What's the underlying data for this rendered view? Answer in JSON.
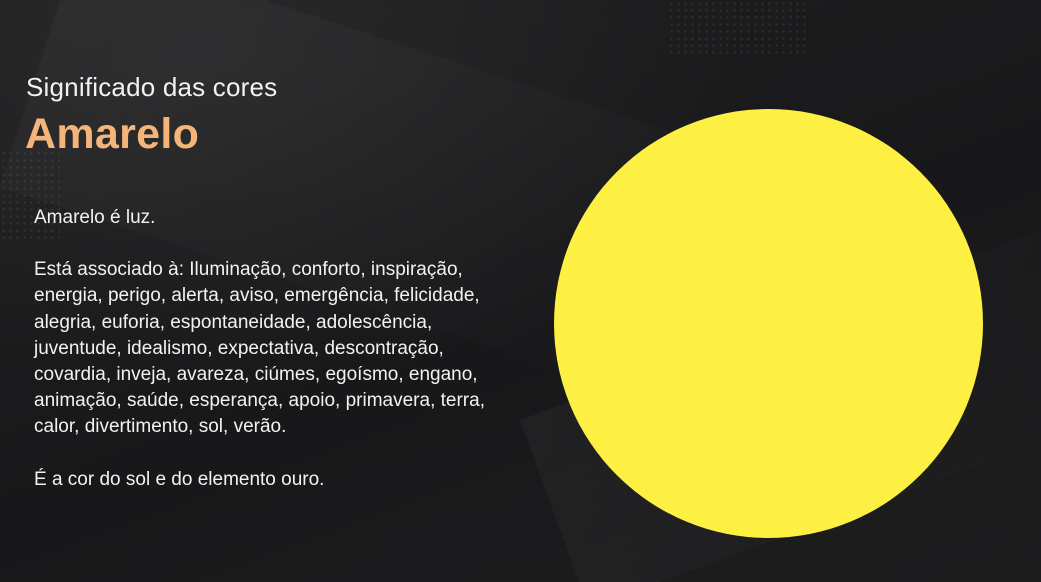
{
  "slide": {
    "subtitle": "Significado das cores",
    "title": "Amarelo",
    "intro": "Amarelo é luz.",
    "associations": "Está associado à: Iluminação, conforto, inspiração, energia, perigo, alerta, aviso, emergência, felicidade, alegria, euforia, espontaneidade, adolescência, juventude, idealismo, expectativa, descontração, covardia, inveja, avareza, ciúmes, egoísmo, engano, animação, saúde, esperança, apoio, primavera, terra, calor, divertimento, sol, verão.",
    "closing": "É a cor do sol e do elemento ouro."
  },
  "colors": {
    "background": "#1b1b1c",
    "title": "#f4b47a",
    "text": "#f2f2f2",
    "swatch": "#fdf042"
  }
}
